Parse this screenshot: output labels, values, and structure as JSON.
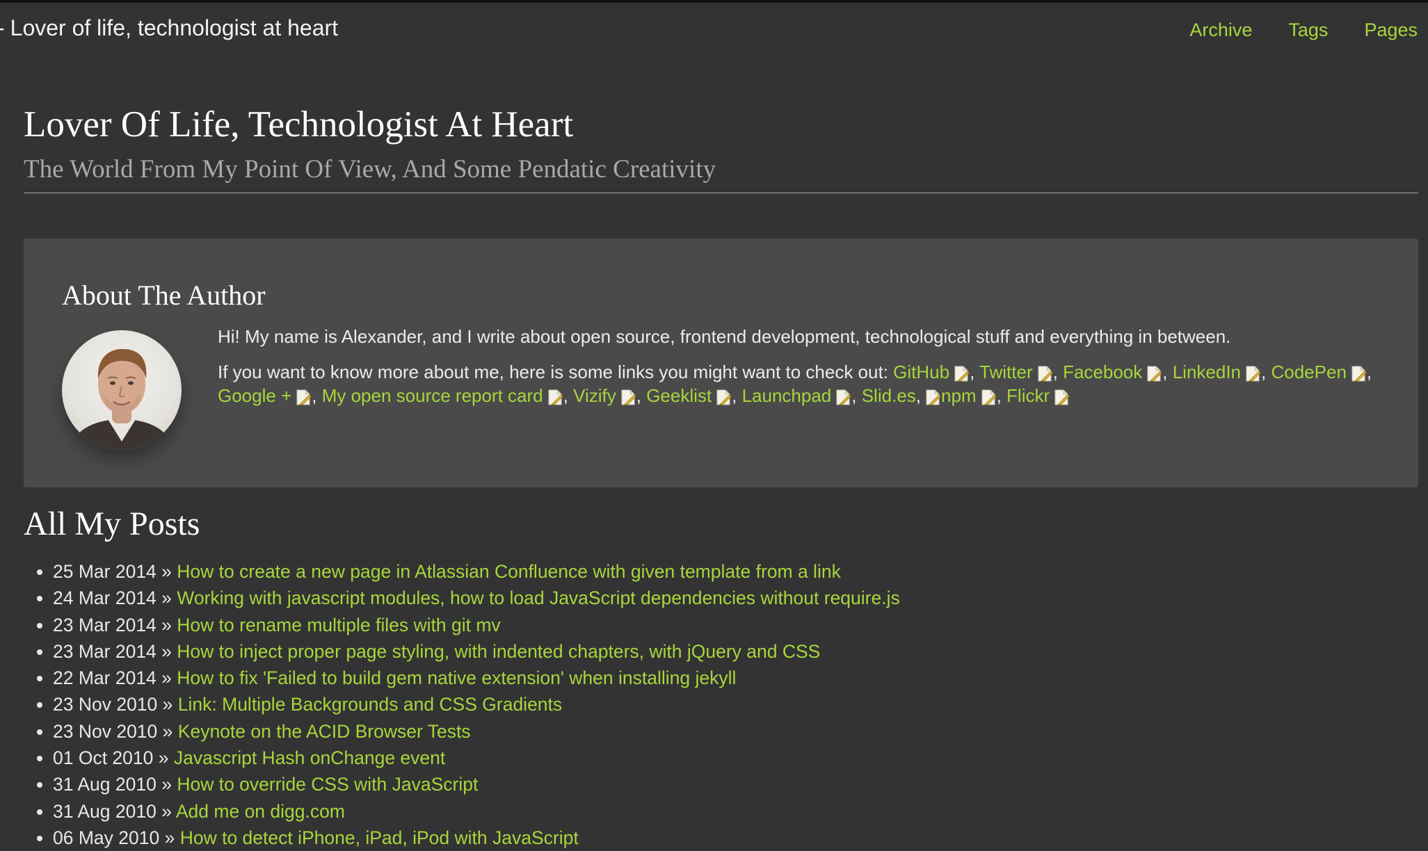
{
  "navbar": {
    "brand": "Lover of life, technologist at heart",
    "links": [
      "Archive",
      "Tags",
      "Pages"
    ]
  },
  "header": {
    "title": "Lover Of Life, Technologist At Heart",
    "subtitle": "The World From My Point Of View, And Some Pendatic Creativity"
  },
  "about": {
    "title": "About The Author",
    "intro": "Hi! My name is Alexander, and I write about open source, frontend development, technological stuff and everything in between.",
    "links_intro": "If you want to know more about me, here is some links you might want to check out:",
    "links": [
      "GitHub",
      "Twitter",
      "Facebook",
      "LinkedIn",
      "CodePen",
      "Google +",
      "My open source report card",
      "Vizify",
      "Geeklist",
      "Launchpad",
      "Slid.es",
      "npm",
      "Flickr"
    ]
  },
  "posts": {
    "title": "All My Posts",
    "separator": "»",
    "items": [
      {
        "date": "25 Mar 2014",
        "title": "How to create a new page in Atlassian Confluence with given template from a link"
      },
      {
        "date": "24 Mar 2014",
        "title": "Working with javascript modules, how to load JavaScript dependencies without require.js"
      },
      {
        "date": "23 Mar 2014",
        "title": "How to rename multiple files with git mv"
      },
      {
        "date": "23 Mar 2014",
        "title": "How to inject proper page styling, with indented chapters, with jQuery and CSS"
      },
      {
        "date": "22 Mar 2014",
        "title": "How to fix 'Failed to build gem native extension' when installing jekyll"
      },
      {
        "date": "23 Nov 2010",
        "title": "Link: Multiple Backgrounds and CSS Gradients"
      },
      {
        "date": "23 Nov 2010",
        "title": "Keynote on the ACID Browser Tests"
      },
      {
        "date": "01 Oct 2010",
        "title": "Javascript Hash onChange event"
      },
      {
        "date": "31 Aug 2010",
        "title": "How to override CSS with JavaScript"
      },
      {
        "date": "31 Aug 2010",
        "title": "Add me on digg.com"
      },
      {
        "date": "06 May 2010",
        "title": "How to detect iPhone, iPad, iPod with JavaScript"
      }
    ]
  },
  "colors": {
    "background": "#333333",
    "panel": "#4a4a4a",
    "link": "#a8d63c",
    "text": "#e8e8e8"
  }
}
